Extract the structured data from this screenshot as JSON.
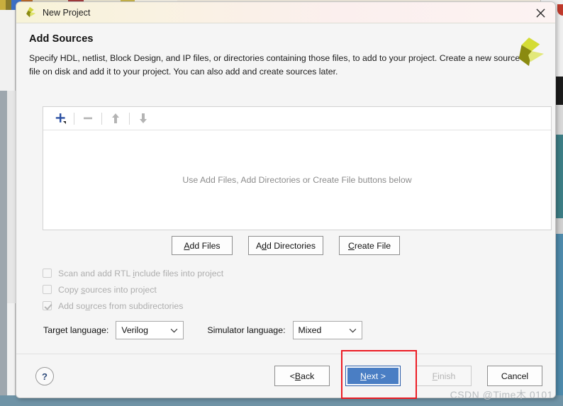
{
  "window": {
    "title": "New Project",
    "logo_icon": "xilinx-logo-icon",
    "close_icon": "close-icon"
  },
  "header": {
    "title": "Add Sources",
    "description": "Specify HDL, netlist, Block Design, and IP files, or directories containing those files, to add to your project. Create a new source file on disk and add it to your project. You can also add and create sources later.",
    "corner_logo_icon": "xilinx-pinwheel-logo-icon"
  },
  "sources_panel": {
    "toolbar": [
      {
        "name": "add-button",
        "icon": "plus-icon",
        "color": "#2a4fa2",
        "enabled": true
      },
      {
        "name": "remove-button",
        "icon": "minus-icon",
        "color": "#b0b0b0",
        "enabled": false
      },
      {
        "name": "move-up-button",
        "icon": "arrow-up-icon",
        "color": "#b0b0b0",
        "enabled": false
      },
      {
        "name": "move-down-button",
        "icon": "arrow-down-icon",
        "color": "#b0b0b0",
        "enabled": false
      }
    ],
    "empty_message": "Use Add Files, Add Directories or Create File buttons below"
  },
  "action_buttons": [
    {
      "name": "add-files-button",
      "label": "Add Files",
      "mnemonic_index": 0,
      "enabled": true
    },
    {
      "name": "add-directories-button",
      "label": "Add Directories",
      "mnemonic_index": 1,
      "enabled": true
    },
    {
      "name": "create-file-button",
      "label": "Create File",
      "mnemonic_index": 0,
      "enabled": true
    }
  ],
  "checkboxes": [
    {
      "name": "scan-rtl-include-checkbox",
      "label": "Scan and add RTL include files into project",
      "checked": false,
      "enabled": false,
      "mnemonic_index": 17
    },
    {
      "name": "copy-sources-checkbox",
      "label": "Copy sources into project",
      "checked": false,
      "enabled": false,
      "mnemonic_index": 5
    },
    {
      "name": "add-subdirectories-checkbox",
      "label": "Add sources from subdirectories",
      "checked": true,
      "enabled": false,
      "mnemonic_index": 6
    }
  ],
  "language_row": {
    "target_label": "Target language:",
    "target_value": "Verilog",
    "simulator_label": "Simulator language:",
    "simulator_value": "Mixed"
  },
  "footer": {
    "help_label": "?",
    "buttons": [
      {
        "name": "back-button",
        "label": "< Back",
        "enabled": true,
        "primary": false,
        "mnemonic": "B"
      },
      {
        "name": "next-button",
        "label": "Next >",
        "enabled": true,
        "primary": true,
        "mnemonic": "N"
      },
      {
        "name": "finish-button",
        "label": "Finish",
        "enabled": false,
        "primary": false,
        "mnemonic": "F"
      },
      {
        "name": "cancel-button",
        "label": "Cancel",
        "enabled": true,
        "primary": false,
        "mnemonic": ""
      }
    ]
  },
  "annotation": {
    "name": "red-highlight-box",
    "color": "#ec1c24",
    "targets": "next-button"
  },
  "watermark": {
    "text": "CSDN @Time木 0101"
  }
}
